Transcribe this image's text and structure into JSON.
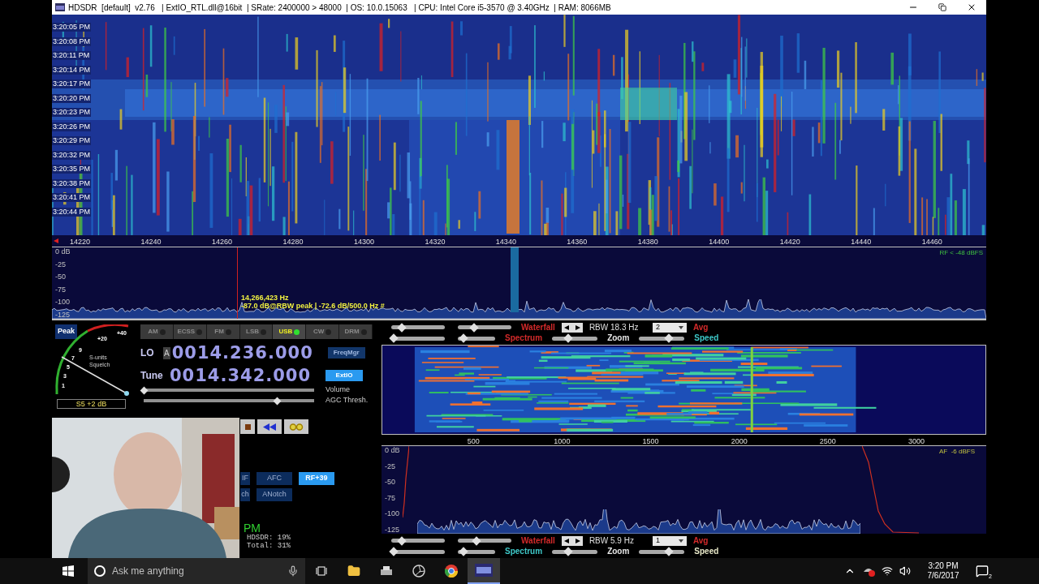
{
  "window": {
    "title": "HDSDR  [default]  v2.76   | ExtIO_RTL.dll@16bit  | SRate: 2400000 > 48000  | OS: 10.0.15063   | CPU: Intel Core i5-3570 @ 3.40GHz  | RAM: 8066MB"
  },
  "waterfall": {
    "times": [
      "3:20:05 PM",
      "3:20:08 PM",
      "3:20:11 PM",
      "3:20:14 PM",
      "3:20:17 PM",
      "3:20:20 PM",
      "3:20:23 PM",
      "3:20:26 PM",
      "3:20:29 PM",
      "3:20:32 PM",
      "3:20:35 PM",
      "3:20:38 PM",
      "3:20:41 PM",
      "3:20:44 PM"
    ]
  },
  "rf_axis": {
    "ticks": [
      "14220",
      "14240",
      "14260",
      "14280",
      "14300",
      "14320",
      "14340",
      "14360",
      "14380",
      "14400",
      "14420",
      "14440",
      "14460"
    ]
  },
  "rf_spectrum": {
    "yticks": [
      "0 dB",
      "-25",
      "-50",
      "-75",
      "-100",
      "-125"
    ],
    "level_note": "RF < -48 dBFS",
    "cursor_freq": "14,266,423 Hz",
    "cursor_reading": "-87.0 dB@RBW peak | -72.6 dB/500.0 Hz #"
  },
  "meter": {
    "peak": "Peak",
    "scale": [
      "+40",
      "+20",
      "9",
      "7",
      "5",
      "3",
      "1"
    ],
    "label_top": "S-units",
    "label_bottom": "Squelch",
    "reading": "S5 +2 dB"
  },
  "modes": [
    {
      "label": "AM",
      "selected": false
    },
    {
      "label": "ECSS",
      "selected": false
    },
    {
      "label": "FM",
      "selected": false
    },
    {
      "label": "LSB",
      "selected": false
    },
    {
      "label": "USB",
      "selected": true
    },
    {
      "label": "CW",
      "selected": false
    },
    {
      "label": "DRM",
      "selected": false
    }
  ],
  "lo": {
    "label": "LO",
    "tag": "A",
    "value": "0014.236.000",
    "button": {
      "label": "FreqMgr",
      "selected": false
    }
  },
  "tune": {
    "label": "Tune",
    "value": "0014.342.000",
    "button": {
      "label": "ExtIO",
      "selected": true
    }
  },
  "sliders": [
    {
      "label": "Volume",
      "level": 0.0
    },
    {
      "label": "AGC Thresh.",
      "level": 0.78
    }
  ],
  "dsp_buttons": [
    [
      {
        "label": "IF",
        "selected": false
      },
      {
        "label": "AFC",
        "selected": false
      },
      {
        "label": "RF+39",
        "selected": true
      }
    ],
    [
      {
        "label": "ch",
        "selected": false
      },
      {
        "label": "ANotch",
        "selected": false
      }
    ]
  ],
  "clock": "PM",
  "cpu": [
    "HDSDR: 19%",
    "Total: 31%"
  ],
  "af_top_controls": {
    "labels": [
      {
        "text": "Waterfall",
        "color": "#d42a2a"
      },
      {
        "text": "Spectrum",
        "color": "#d42a2a"
      },
      {
        "text": "Zoom",
        "color": "#e8e8e8"
      },
      {
        "text": "Speed",
        "color": "#3ec8c8"
      }
    ],
    "rbw": "RBW 18.3 Hz",
    "avg_value": "2",
    "avg_label": "Avg",
    "sliders": [
      {
        "level": 0.2
      },
      {
        "level": 0.3
      },
      {
        "level": 0.05
      },
      {
        "level": 0.15
      },
      {
        "level": 0.35
      },
      {
        "level": 0.65
      }
    ]
  },
  "af_axis": {
    "ticks": [
      "500",
      "1000",
      "1500",
      "2000",
      "2500",
      "3000"
    ]
  },
  "af_spectrum": {
    "yticks": [
      "0 dB",
      "-25",
      "-50",
      "-75",
      "-100",
      "-125"
    ],
    "level_note": "AF  -6 dBFS"
  },
  "af_bottom_controls": {
    "labels": [
      {
        "text": "Waterfall",
        "color": "#d42a2a"
      },
      {
        "text": "Spectrum",
        "color": "#3ec8c8"
      },
      {
        "text": "Zoom",
        "color": "#e8e8e8"
      },
      {
        "text": "Speed",
        "color": "#e8e8c8"
      }
    ],
    "rbw": "RBW  5.9 Hz",
    "avg_value": "1",
    "avg_label": "Avg",
    "sliders": [
      {
        "level": 0.2
      },
      {
        "level": 0.35
      },
      {
        "level": 0.05
      },
      {
        "level": 0.15
      },
      {
        "level": 0.35
      },
      {
        "level": 0.65
      }
    ]
  },
  "taskbar": {
    "search_placeholder": "Ask me anything",
    "time": "3:20 PM",
    "date": "7/6/2017",
    "notifications": "2"
  }
}
